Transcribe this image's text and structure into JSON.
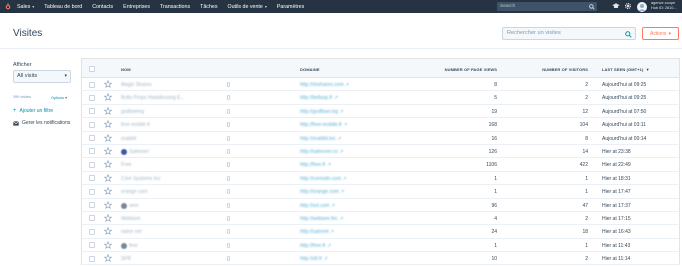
{
  "nav": {
    "logo_icon": "hubspot-sprocket-icon",
    "items": [
      {
        "label": "Sales",
        "caret": true
      },
      {
        "label": "Tableau de bord",
        "caret": false
      },
      {
        "label": "Contacts",
        "caret": false
      },
      {
        "label": "Entreprises",
        "caret": false
      },
      {
        "label": "Transactions",
        "caret": false
      },
      {
        "label": "Tâches",
        "caret": false
      },
      {
        "label": "Outils de vente",
        "caret": true
      },
      {
        "label": "Paramètres",
        "caret": false
      }
    ],
    "search_placeholder": "Search",
    "account_line1": "agence-coupe",
    "account_line2": "Hub ID: 2810..."
  },
  "header": {
    "title": "Visites",
    "search_placeholder": "Rechercher un visites",
    "actions_label": "Actions"
  },
  "sidebar": {
    "filter_label": "Afficher",
    "selected_view": "All visits",
    "count_text": "399 visites",
    "options_label": "Options",
    "add_filter_label": "Ajouter un filtre",
    "notifications_label": "Gerer les notifications"
  },
  "table": {
    "headers": {
      "name": "NOM",
      "domain": "DOMAINE",
      "page_views": "NUMBER OF PAGE VIEWS",
      "visitors": "NUMBER OF VISITORS",
      "last_seen": "LAST SEEN (GMT+1)"
    },
    "rows": [
      {
        "name": "Magic Shares",
        "domain": "http://shshares.com ↗",
        "page_views": "8",
        "visitors": "2",
        "last_seen": "Aujourd'hui at 09:25",
        "avatar": false
      },
      {
        "name": "Bolts Props Hautdessing E...",
        "domain": "http://bellssp.fr ↗",
        "page_views": "5",
        "visitors": "2",
        "last_seen": "Aujourd'hui at 09:25",
        "avatar": false
      },
      {
        "name": "godlsering",
        "domain": "http://godfiser.ing ↗",
        "page_views": "19",
        "visitors": "12",
        "last_seen": "Aujourd'hui at 07:50",
        "avatar": false
      },
      {
        "name": "free mobile fr",
        "domain": "http://free-mobile.fr ↗",
        "page_views": "168",
        "visitors": "104",
        "last_seen": "Aujourd'hui at 03:11",
        "avatar": false
      },
      {
        "name": "orabbit",
        "domain": "http://orabbit.tec ↗",
        "page_views": "16",
        "visitors": "8",
        "last_seen": "Aujourd'hui at 00:14",
        "avatar": false
      },
      {
        "name": "Saleover",
        "domain": "http://saleover.co ↗",
        "page_views": "126",
        "visitors": "14",
        "last_seen": "Hier at 23:38",
        "avatar": true
      },
      {
        "name": "Free",
        "domain": "http://free.fr ↗",
        "page_views": "1106",
        "visitors": "422",
        "last_seen": "Hier at 22:49",
        "avatar": false
      },
      {
        "name": "Core Systems Inc",
        "domain": "http://coresdn.com ↗",
        "page_views": "1",
        "visitors": "1",
        "last_seen": "Hier at 18:31",
        "avatar": false
      },
      {
        "name": "orange com",
        "domain": "http://orange.com ↗",
        "page_views": "1",
        "visitors": "1",
        "last_seen": "Hier at 17:47",
        "avatar": false
      },
      {
        "name": "vem",
        "domain": "http://svl.com ↗",
        "page_views": "96",
        "visitors": "47",
        "last_seen": "Hier at 17:37",
        "avatar": true
      },
      {
        "name": "Webisee",
        "domain": "http://websee.fec ↗",
        "page_views": "4",
        "visitors": "2",
        "last_seen": "Hier at 17:15",
        "avatar": false
      },
      {
        "name": "naine net",
        "domain": "http://sainnet ↗",
        "page_views": "24",
        "visitors": "18",
        "last_seen": "Hier at 16:43",
        "avatar": false
      },
      {
        "name": "free",
        "domain": "http://free.fr ↗",
        "page_views": "1",
        "visitors": "1",
        "last_seen": "Hier at 11:43",
        "avatar": true
      },
      {
        "name": "SFR",
        "domain": "http://sfr.fr ↗",
        "page_views": "10",
        "visitors": "2",
        "last_seen": "Hier at 11:14",
        "avatar": false
      }
    ]
  },
  "colors": {
    "nav_bg": "#253342",
    "accent_orange": "#ff7a59",
    "link_blue": "#0091ae"
  }
}
